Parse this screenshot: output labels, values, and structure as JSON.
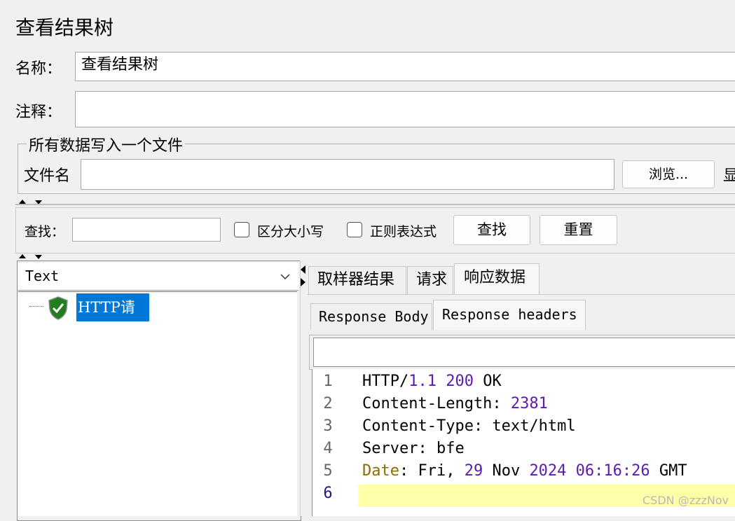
{
  "panel": {
    "title": "查看结果树"
  },
  "name_label": "名称：",
  "name_value": "查看结果树",
  "comment_label": "注释：",
  "comment_value": "",
  "file_group": {
    "legend": "所有数据写入一个文件",
    "filename_label": "文件名",
    "filename_value": "",
    "browse_label": "浏览...",
    "cut_label": "显"
  },
  "search": {
    "label": "查找：",
    "value": "",
    "case_label": "区分大小写",
    "regex_label": "正则表达式",
    "find_button": "查找",
    "reset_button": "重置"
  },
  "renderer_select": {
    "selected": "Text"
  },
  "tree": {
    "items": [
      {
        "label": "HTTP请求",
        "status": "success"
      }
    ]
  },
  "main_tabs": [
    {
      "label": "取样器结果"
    },
    {
      "label": "请求"
    },
    {
      "label": "响应数据"
    }
  ],
  "sub_tabs": [
    {
      "label": "Response Body"
    },
    {
      "label": "Response headers"
    }
  ],
  "editor_search_value": "",
  "editor": {
    "line_numbers": [
      "1",
      "2",
      "3",
      "4",
      "5",
      "6"
    ],
    "lines": [
      {
        "a": "HTTP/",
        "b": "1.1 200",
        "c": " OK"
      },
      {
        "a": "Content-Length: ",
        "b": "2381",
        "c": ""
      },
      {
        "a": "Content-Type: text/html",
        "b": "",
        "c": ""
      },
      {
        "a": "Server: bfe",
        "b": "",
        "c": ""
      },
      {
        "a": "Date",
        "b": ": Fri, ",
        "c": "29",
        "d": " Nov ",
        "e": "2024 06:16:26",
        "f": " GMT"
      },
      {
        "a": "",
        "b": "",
        "c": ""
      }
    ]
  },
  "watermark": "CSDN @zzzNov"
}
